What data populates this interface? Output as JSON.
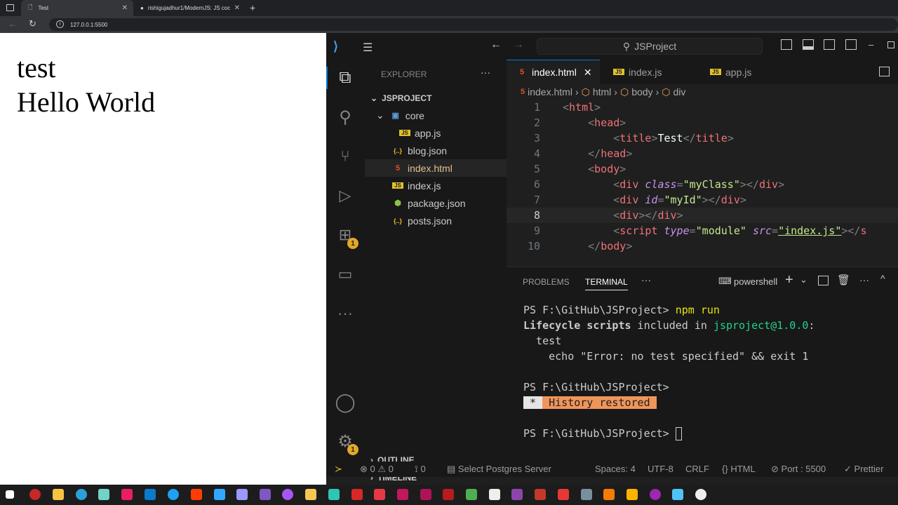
{
  "browser": {
    "tabs": [
      {
        "title": "Test",
        "close": "✕"
      },
      {
        "title": "rishigujadhur1/ModernJS: JS coc",
        "close": "✕"
      }
    ],
    "new_tab": "+",
    "url": "127.0.0.1:5500"
  },
  "preview": {
    "lines": [
      "test",
      "Hello World"
    ]
  },
  "vscode": {
    "command_center": "JSProject",
    "explorer_title": "EXPLORER",
    "project_name": "JSPROJECT",
    "tree": [
      {
        "name": "core",
        "type": "folder",
        "depth": 1
      },
      {
        "name": "app.js",
        "type": "js",
        "depth": 2
      },
      {
        "name": "blog.json",
        "type": "json",
        "depth": 1
      },
      {
        "name": "index.html",
        "type": "html",
        "depth": 1,
        "selected": true
      },
      {
        "name": "index.js",
        "type": "js",
        "depth": 1
      },
      {
        "name": "package.json",
        "type": "npm",
        "depth": 1
      },
      {
        "name": "posts.json",
        "type": "json",
        "depth": 1
      }
    ],
    "outline_label": "OUTLINE",
    "timeline_label": "TIMELINE",
    "editor_tabs": [
      {
        "name": "index.html",
        "type": "html",
        "active": true
      },
      {
        "name": "index.js",
        "type": "js"
      },
      {
        "name": "app.js",
        "type": "js"
      }
    ],
    "breadcrumb": [
      "index.html",
      "html",
      "body",
      "div"
    ],
    "code_lines": [
      {
        "n": "1",
        "html": "<span class='br'>&lt;</span><span class='tag'>html</span><span class='br'>&gt;</span>"
      },
      {
        "n": "2",
        "html": "    <span class='br'>&lt;</span><span class='tag'>head</span><span class='br'>&gt;</span>"
      },
      {
        "n": "3",
        "html": "        <span class='br'>&lt;</span><span class='tag'>title</span><span class='br'>&gt;</span><span class='txt'>Test</span><span class='br'>&lt;/</span><span class='tag'>title</span><span class='br'>&gt;</span>"
      },
      {
        "n": "4",
        "html": "    <span class='br'>&lt;/</span><span class='tag'>head</span><span class='br'>&gt;</span>"
      },
      {
        "n": "5",
        "html": "    <span class='br'>&lt;</span><span class='tag'>body</span><span class='br'>&gt;</span>"
      },
      {
        "n": "6",
        "html": "        <span class='br'>&lt;</span><span class='tag'>div</span> <span class='attr'>class</span><span class='br'>=</span><span class='str'>\"myClass\"</span><span class='br'>&gt;&lt;/</span><span class='tag'>div</span><span class='br'>&gt;</span>"
      },
      {
        "n": "7",
        "html": "        <span class='br'>&lt;</span><span class='tag'>div</span> <span class='attr'>id</span><span class='br'>=</span><span class='str'>\"myId\"</span><span class='br'>&gt;&lt;/</span><span class='tag'>div</span><span class='br'>&gt;</span>"
      },
      {
        "n": "8",
        "html": "        <span class='br'>&lt;</span><span class='tag'>div</span><span class='br'>&gt;&lt;/</span><span class='tag'>div</span><span class='br'>&gt;</span>"
      },
      {
        "n": "9",
        "html": "        <span class='br'>&lt;</span><span class='tag'>script</span> <span class='attr'>type</span><span class='br'>=</span><span class='str'>\"module\"</span> <span class='attr'>src</span><span class='br'>=</span><span class='str' style='text-decoration:underline'>\"index.js\"</span><span class='br'>&gt;&lt;/</span><span class='tag'>s</span>"
      },
      {
        "n": "10",
        "html": "    <span class='br'>&lt;/</span><span class='tag'>body</span><span class='br'>&gt;</span>"
      }
    ],
    "current_line": "8",
    "panel_tabs": [
      "PROBLEMS",
      "TERMINAL"
    ],
    "terminal_shell": "powershell",
    "terminal": {
      "l1_prompt": "PS F:\\GitHub\\JSProject> ",
      "l1_cmd": "npm run",
      "l2_a": "Lifecycle scripts",
      "l2_b": " included in ",
      "l2_c": "jsproject@1.0.0",
      "l2_d": ":",
      "l3": "  test",
      "l4": "    echo \"Error: no test specified\" && exit 1",
      "l5": "PS F:\\GitHub\\JSProject>",
      "history_star": " * ",
      "history": " History restored ",
      "l7": "PS F:\\GitHub\\JSProject> "
    },
    "status": {
      "errors": "0",
      "warnings": "0",
      "ports": "0",
      "postgres": "Select Postgres Server",
      "spaces": "Spaces: 4",
      "encoding": "UTF-8",
      "eol": "CRLF",
      "language": "HTML",
      "port": "Port : 5500",
      "prettier": "Prettier"
    },
    "badges": {
      "source_control": "1",
      "settings": "1"
    }
  },
  "colors": {
    "accent": "#0078d4",
    "badge": "#e2a82a",
    "history_bg": "#f0955a"
  }
}
